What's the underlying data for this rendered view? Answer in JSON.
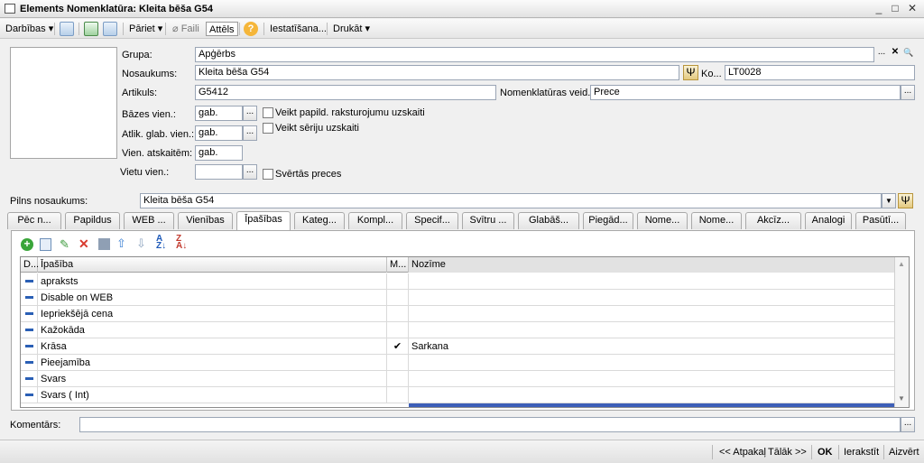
{
  "window": {
    "title": "Elements Nomenklatūra: Kleita bēša G54",
    "minimize": "_",
    "maximize": "□",
    "close": "✕"
  },
  "toolbar": {
    "actions": "Darbības",
    "goto": "Pāriet",
    "files": "Faili",
    "image": "Attēls",
    "help": "?",
    "settings": "Iestatīšana...",
    "print": "Drukāt"
  },
  "form": {
    "group_label": "Grupa:",
    "group_value": "Apģērbs",
    "name_label": "Nosaukums:",
    "name_value": "Kleita bēša G54",
    "code_label": "Ko...",
    "code_value": "LT0028",
    "article_label": "Artikuls:",
    "article_value": "G5412",
    "type_label": "Nomenklatūras veid...",
    "type_value": "Prece",
    "base_unit_label": "Bāzes vien.:",
    "base_unit_value": "gab.",
    "storage_unit_label": "Atlik. glab. vien.:",
    "storage_unit_value": "gab.",
    "report_unit_label": "Vien. atskaitēm:",
    "report_unit_value": "gab.",
    "place_unit_label": "Vietu vien.:",
    "place_unit_value": "",
    "chk_extra": "Veikt papild. raksturojumu uzskaiti",
    "chk_serial": "Veikt sēriju uzskaiti",
    "chk_weight": "Svērtās preces",
    "fullname_label": "Pilns nosaukums:",
    "fullname_value": "Kleita bēša G54",
    "comment_label": "Komentārs:",
    "comment_value": "",
    "dots": "...",
    "clear": "✕",
    "search": "🔍"
  },
  "tabs": [
    "Pēc n...",
    "Papildus",
    "WEB ...",
    "Vienības",
    "Īpašības",
    "Kateg...",
    "Kompl...",
    "Specif...",
    "Svītru ...",
    "Glabāš...",
    "Piegād...",
    "Nome...",
    "Nome...",
    "Akcīz...",
    "Analogi",
    "Pasūtī..."
  ],
  "active_tab": 4,
  "grid": {
    "headers": {
      "d": "D...",
      "property": "Īpašība",
      "m": "M...",
      "meaning": "Nozīme"
    },
    "rows": [
      {
        "property": "apraksts",
        "m": "",
        "meaning": ""
      },
      {
        "property": "Disable on WEB",
        "m": "",
        "meaning": ""
      },
      {
        "property": "Iepriekšējā cena",
        "m": "",
        "meaning": ""
      },
      {
        "property": "Kažokāda",
        "m": "",
        "meaning": ""
      },
      {
        "property": "Krāsa",
        "m": "✔",
        "meaning": "Sarkana"
      },
      {
        "property": "Pieejamība",
        "m": "",
        "meaning": ""
      },
      {
        "property": "Svars",
        "m": "",
        "meaning": ""
      },
      {
        "property": "Svars ( Int)",
        "m": "",
        "meaning": ""
      }
    ]
  },
  "statusbar": {
    "back": "<< Atpakaļ",
    "next": "Tālāk >>",
    "ok": "OK",
    "save": "Ierakstīt",
    "close": "Aizvērt"
  }
}
